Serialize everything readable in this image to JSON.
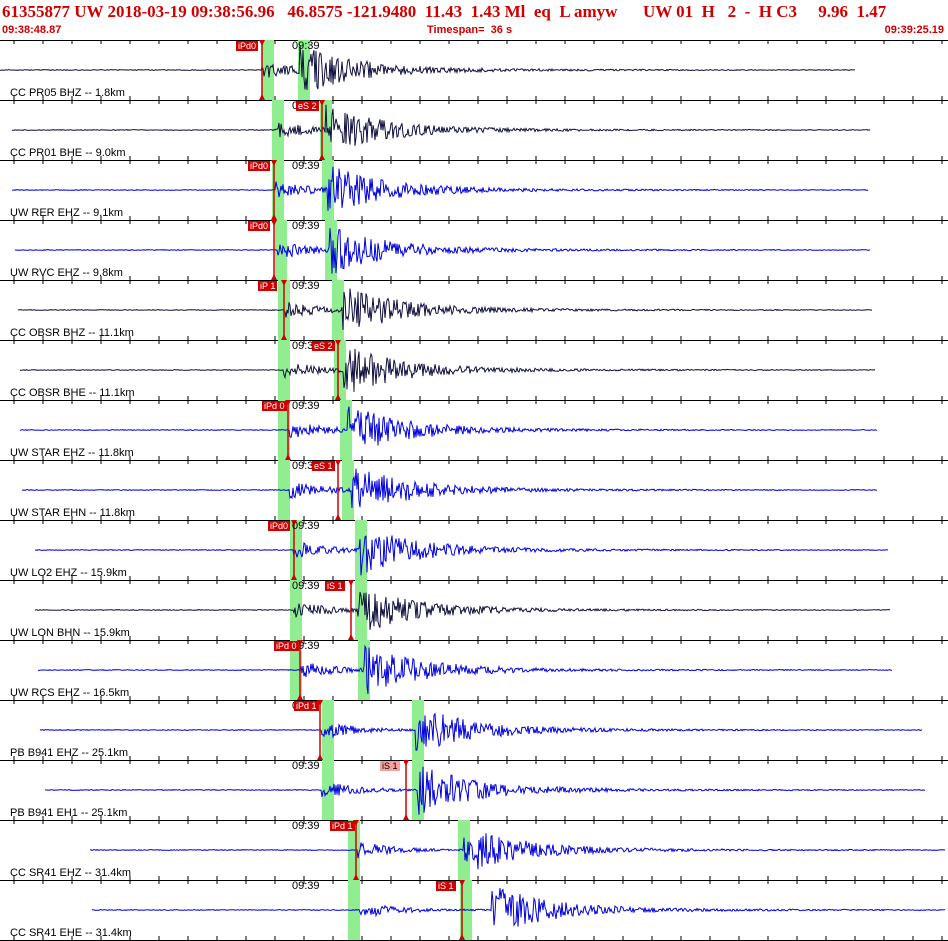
{
  "header": {
    "title": "61355877 UW 2018-03-19 09:38:56.96   46.8575 -121.9480  11.43  1.43 Ml  eq  L amyw      UW 01  H   2  -  H C3     9.96  1.47",
    "start_time": "09:38:48.87",
    "timespan": "Timespan=  36 s",
    "end_time": "09:39:25.19"
  },
  "colors": {
    "header_text": "#d00000",
    "trace_dark": "#101040",
    "trace_blue": "#0000e0",
    "pick_red": "#d00000",
    "window_green": "#90ee90"
  },
  "panels": [
    {
      "label": "CC PR05 BHZ -- 1.8km",
      "minute": "09:39",
      "pick": "iPd0",
      "pick_light": false,
      "color": "dark"
    },
    {
      "label": "CC PR01 BHE -- 9.0km",
      "minute": "09:39",
      "pick": "eS 2",
      "pick_light": false,
      "color": "dark"
    },
    {
      "label": "UW RER EHZ -- 9.1km",
      "minute": "09:39",
      "pick": "iPd0",
      "pick_light": false,
      "color": "blue"
    },
    {
      "label": "UW RVC EHZ -- 9.8km",
      "minute": "09:39",
      "pick": "iPd0",
      "pick_light": false,
      "color": "blue"
    },
    {
      "label": "CC OBSR BHZ -- 11.1km",
      "minute": "09:39",
      "pick": "iP 1",
      "pick_light": false,
      "color": "dark"
    },
    {
      "label": "CC OBSR BHE -- 11.1km",
      "minute": "09:39",
      "pick": "eS 2",
      "pick_light": false,
      "color": "dark"
    },
    {
      "label": "UW STAR EHZ -- 11.8km",
      "minute": "09:39",
      "pick": "iPd 0",
      "pick_light": false,
      "color": "blue"
    },
    {
      "label": "UW STAR EHN -- 11.8km",
      "minute": "09:39",
      "pick": "eS 1",
      "pick_light": false,
      "color": "blue"
    },
    {
      "label": "UW LO2 EHZ -- 15.9km",
      "minute": "09:39",
      "pick": "iPd0",
      "pick_light": false,
      "color": "blue"
    },
    {
      "label": "UW LON BHN -- 15.9km",
      "minute": "09:39",
      "pick": "iS 1",
      "pick_light": false,
      "color": "dark"
    },
    {
      "label": "UW RCS EHZ -- 16.5km",
      "minute": "09:39",
      "pick": "iPd 0",
      "pick_light": false,
      "color": "blue"
    },
    {
      "label": "PB B941 EHZ -- 25.1km",
      "minute": "09:39",
      "pick": "iPd 1",
      "pick_light": false,
      "color": "blue"
    },
    {
      "label": "PB B941 EH1 -- 25.1km",
      "minute": "09:39",
      "pick": "iS 1",
      "pick_light": true,
      "color": "blue"
    },
    {
      "label": "CC SR41 EHZ -- 31.4km",
      "minute": "09:39",
      "pick": "iPd 1",
      "pick_light": false,
      "color": "blue"
    },
    {
      "label": "CC SR41 EHE -- 31.4km",
      "minute": "09:39",
      "pick": "iS 1",
      "pick_light": false,
      "color": "blue"
    }
  ]
}
